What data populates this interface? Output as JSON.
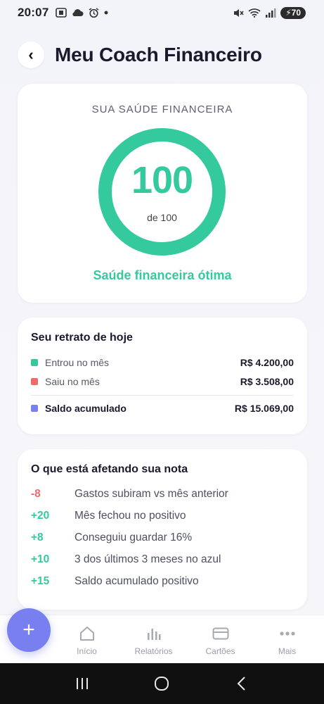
{
  "status_bar": {
    "time": "20:07",
    "battery": "70"
  },
  "header": {
    "back_icon": "‹",
    "title": "Meu Coach Financeiro"
  },
  "health": {
    "label": "SUA SAÚDE FINANCEIRA",
    "score": "100",
    "score_max": "de 100",
    "score_fraction": 1.0,
    "status": "Saúde financeira ótima",
    "accent_color": "#35c99e"
  },
  "snapshot": {
    "title": "Seu retrato de hoje",
    "rows": [
      {
        "label": "Entrou no mês",
        "value": "R$ 4.200,00",
        "color": "#35c99e"
      },
      {
        "label": "Saiu no mês",
        "value": "R$ 3.508,00",
        "color": "#ef6b6b"
      },
      {
        "label": "Saldo acumulado",
        "value": "R$ 15.069,00",
        "color": "#7880f0"
      }
    ]
  },
  "factors": {
    "title": "O que está afetando sua nota",
    "items": [
      {
        "delta": "-8",
        "text": "Gastos subiram vs mês anterior",
        "color": "#ef6b6b"
      },
      {
        "delta": "+20",
        "text": "Mês fechou no positivo",
        "color": "#35c99e"
      },
      {
        "delta": "+8",
        "text": "Conseguiu guardar 16%",
        "color": "#35c99e"
      },
      {
        "delta": "+10",
        "text": "3 dos últimos 3 meses no azul",
        "color": "#35c99e"
      },
      {
        "delta": "+15",
        "text": "Saldo acumulado positivo",
        "color": "#35c99e"
      }
    ]
  },
  "bottom_nav": {
    "fab_label": "+",
    "items": [
      {
        "label": "Início",
        "icon": "home-icon"
      },
      {
        "label": "Relatórios",
        "icon": "bar-chart-icon"
      },
      {
        "label": "Cartões",
        "icon": "card-icon"
      },
      {
        "label": "Mais",
        "icon": "more-icon"
      }
    ]
  }
}
